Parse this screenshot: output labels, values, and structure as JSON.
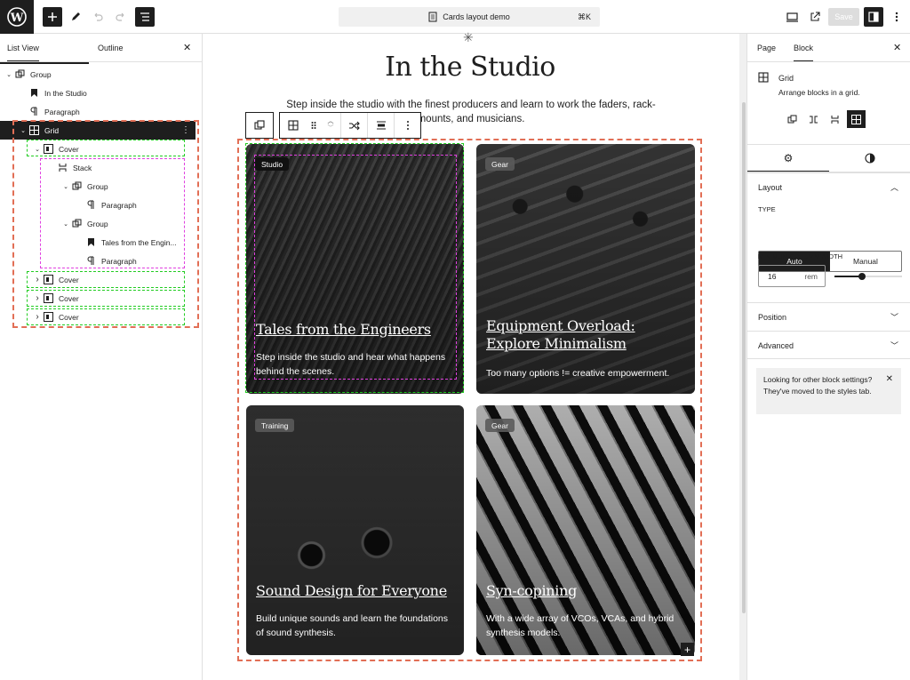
{
  "topbar": {
    "doc_title": "Cards layout demo",
    "shortcut": "⌘K",
    "save_label": "Save"
  },
  "list_view": {
    "tab_list": "List View",
    "tab_outline": "Outline",
    "items": [
      {
        "label": "Group",
        "icon": "group-icon",
        "depth": 0,
        "expanded": true
      },
      {
        "label": "In the Studio",
        "icon": "bookmark-icon",
        "depth": 1
      },
      {
        "label": "Paragraph",
        "icon": "paragraph-icon",
        "depth": 1
      },
      {
        "label": "Grid",
        "icon": "grid-icon",
        "depth": 1,
        "selected": true
      },
      {
        "label": "Cover",
        "icon": "cover-icon",
        "depth": 2,
        "expanded": true
      },
      {
        "label": "Stack",
        "icon": "stack-icon",
        "depth": 3
      },
      {
        "label": "Group",
        "icon": "group-icon",
        "depth": 4
      },
      {
        "label": "Paragraph",
        "icon": "paragraph-icon",
        "depth": 5
      },
      {
        "label": "Group",
        "icon": "group-icon",
        "depth": 4
      },
      {
        "label": "Tales from the Engin...",
        "icon": "bookmark-icon",
        "depth": 5
      },
      {
        "label": "Paragraph",
        "icon": "paragraph-icon",
        "depth": 5
      },
      {
        "label": "Cover",
        "icon": "cover-icon",
        "depth": 2
      },
      {
        "label": "Cover",
        "icon": "cover-icon",
        "depth": 2
      },
      {
        "label": "Cover",
        "icon": "cover-icon",
        "depth": 2
      }
    ]
  },
  "canvas": {
    "heading": "In the Studio",
    "intro": "Step inside the studio with the finest producers and learn to work the faders, rack-mounts, and musicians.",
    "cards": [
      {
        "tag": "Studio",
        "title": "Tales from the Engineers",
        "text": "Step inside the studio and hear what happens behind the scenes."
      },
      {
        "tag": "Gear",
        "title": "Equipment Overload: Explore Minimalism",
        "text": "Too many options != creative empowerment."
      },
      {
        "tag": "Training",
        "title": "Sound Design for Everyone",
        "text": "Build unique sounds and learn the foundations of sound synthesis."
      },
      {
        "tag": "Gear",
        "title": "Syn-copining",
        "text": "With a wide array of VCOs, VCAs, and hybrid synthesis models."
      }
    ]
  },
  "inspector": {
    "tab_page": "Page",
    "tab_block": "Block",
    "block_name": "Grid",
    "block_desc": "Arrange blocks in a grid.",
    "layout_label": "Layout",
    "type_label": "TYPE",
    "type_auto": "Auto",
    "type_manual": "Manual",
    "min_col_label": "MINIMUM COLUMN WIDTH",
    "min_col_value": "16",
    "min_col_unit": "rem",
    "position_label": "Position",
    "advanced_label": "Advanced",
    "notice": "Looking for other block settings? They've moved to the styles tab."
  },
  "colors": {
    "accent_dark": "#1e1e1e",
    "outline_orange": "#e26f56",
    "outline_green": "#22cc22",
    "outline_pink": "#e040e0"
  }
}
